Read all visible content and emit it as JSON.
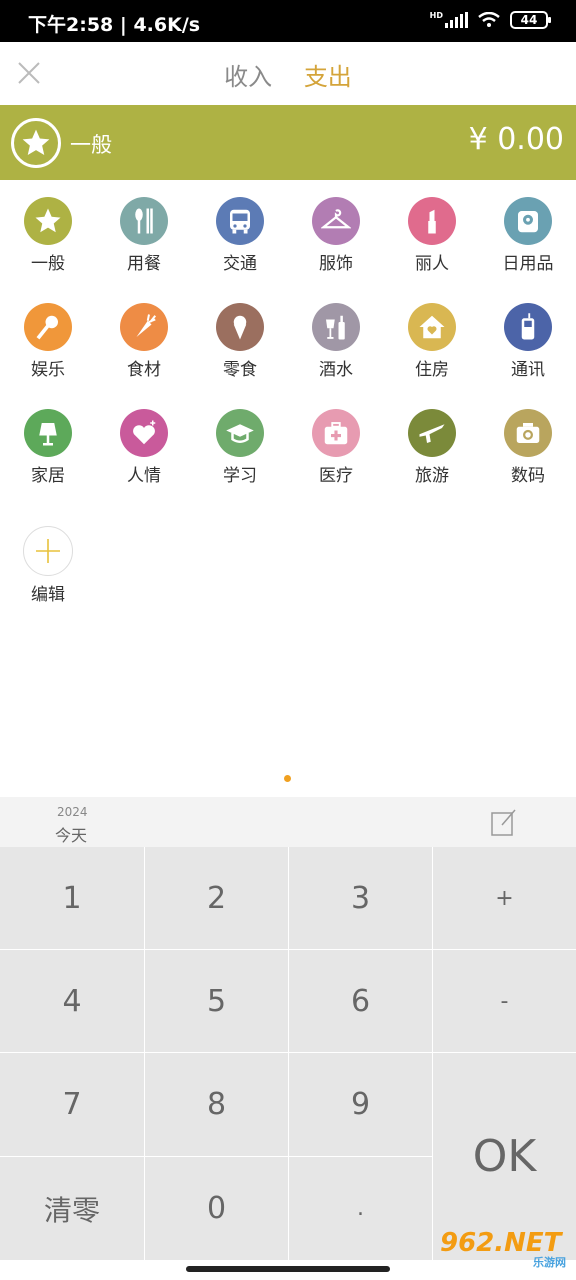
{
  "status": {
    "time": "下午2:58",
    "speed": "4.6K/s",
    "network": "HD",
    "battery": "44"
  },
  "header": {
    "tab_income": "收入",
    "tab_expense": "支出"
  },
  "banner": {
    "category": "一般",
    "amount": "¥ 0.00"
  },
  "categories": [
    {
      "label": "一般",
      "color": "#aeb244",
      "icon": "star-icon"
    },
    {
      "label": "用餐",
      "color": "#7fa9a7",
      "icon": "spoon-fork-icon"
    },
    {
      "label": "交通",
      "color": "#5c7bb5",
      "icon": "bus-icon"
    },
    {
      "label": "服饰",
      "color": "#b27db3",
      "icon": "hanger-icon"
    },
    {
      "label": "丽人",
      "color": "#e06b8d",
      "icon": "lipstick-icon"
    },
    {
      "label": "日用品",
      "color": "#6aa1b2",
      "icon": "tissue-roll-icon"
    },
    {
      "label": "娱乐",
      "color": "#f0973a",
      "icon": "microphone-icon"
    },
    {
      "label": "食材",
      "color": "#ee8c45",
      "icon": "carrot-icon"
    },
    {
      "label": "零食",
      "color": "#9b6f5f",
      "icon": "ice-cream-icon"
    },
    {
      "label": "酒水",
      "color": "#a097a6",
      "icon": "bottle-glass-icon"
    },
    {
      "label": "住房",
      "color": "#d9b752",
      "icon": "house-heart-icon"
    },
    {
      "label": "通讯",
      "color": "#4c64a8",
      "icon": "phone-icon"
    },
    {
      "label": "家居",
      "color": "#5da95a",
      "icon": "lamp-icon"
    },
    {
      "label": "人情",
      "color": "#c95a9b",
      "icon": "heart-sparkle-icon"
    },
    {
      "label": "学习",
      "color": "#6fab6c",
      "icon": "graduation-cap-icon"
    },
    {
      "label": "医疗",
      "color": "#e79bb1",
      "icon": "medical-kit-icon"
    },
    {
      "label": "旅游",
      "color": "#7b8a3a",
      "icon": "airplane-icon"
    },
    {
      "label": "数码",
      "color": "#b9a55e",
      "icon": "camera-icon"
    }
  ],
  "edit_label": "编辑",
  "date": {
    "year": "2024",
    "day": "今天"
  },
  "keys": {
    "k1": "1",
    "k2": "2",
    "k3": "3",
    "plus": "+",
    "k4": "4",
    "k5": "5",
    "k6": "6",
    "minus": "-",
    "k7": "7",
    "k8": "8",
    "k9": "9",
    "ok": "OK",
    "clear": "清零",
    "k0": "0",
    "dot": "."
  },
  "watermark": {
    "main": "962.NET",
    "sub": "乐游网"
  }
}
